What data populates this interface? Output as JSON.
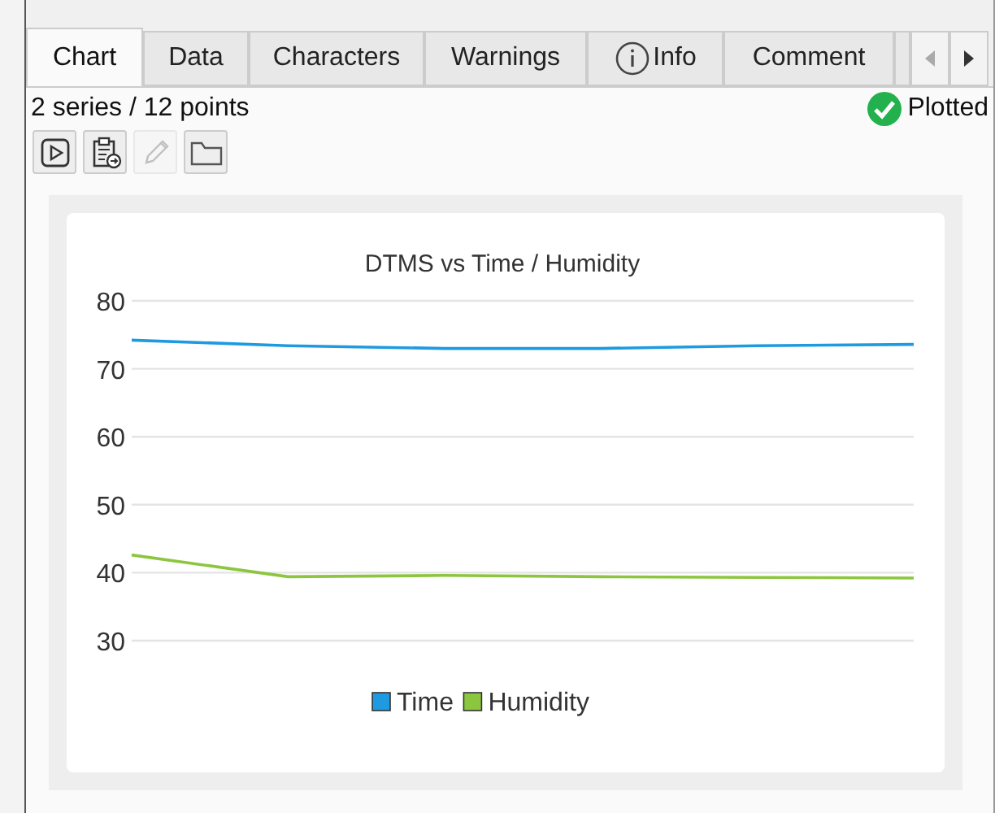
{
  "tabs": [
    {
      "label": "Chart",
      "selected": true,
      "kind": "text"
    },
    {
      "label": "Data",
      "selected": false,
      "kind": "text"
    },
    {
      "label": "Characters",
      "selected": false,
      "kind": "text"
    },
    {
      "label": "Warnings",
      "selected": false,
      "kind": "text"
    },
    {
      "label": "Info",
      "selected": false,
      "kind": "info"
    },
    {
      "label": "Comment",
      "selected": false,
      "kind": "text"
    }
  ],
  "summary": "2 series / 12 points",
  "status": {
    "label": "Plotted",
    "ok": true
  },
  "toolbar": [
    {
      "kind": "play",
      "disabled": false
    },
    {
      "kind": "paste",
      "disabled": false
    },
    {
      "kind": "edit",
      "disabled": true
    },
    {
      "kind": "folder",
      "disabled": false
    }
  ],
  "chart": {
    "chart_data": {
      "type": "line",
      "grid": true,
      "legend": "bottom",
      "title": "DTMS vs Time / Humidity",
      "ylim": [
        30,
        80
      ],
      "yticks": [
        30,
        40,
        50,
        60,
        70,
        80
      ],
      "series": [
        {
          "name": "Time",
          "color": "#1e9be0",
          "values": [
            74.2,
            73.4,
            73.0,
            73.0,
            73.4,
            73.6
          ]
        },
        {
          "name": "Humidity",
          "color": "#8cc63f",
          "values": [
            42.6,
            39.4,
            39.6,
            39.4,
            39.3,
            39.2
          ]
        }
      ]
    }
  }
}
